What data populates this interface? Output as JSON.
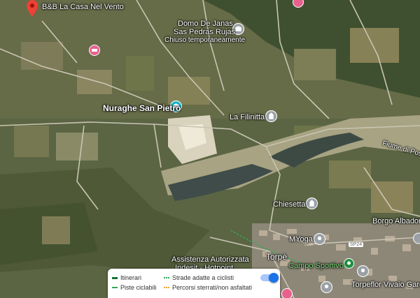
{
  "map": {
    "places": [
      {
        "id": "bb",
        "name": "B&B La Casa Nel Vento"
      },
      {
        "id": "domo",
        "name": "Domo De Janas Sas Pedras Rujas",
        "line1": "Domo De Janas",
        "line2": "Sas Pedras Rujas",
        "status": "Chiuso temporaneamente"
      },
      {
        "id": "nuraghe",
        "name": "Nuraghe San Pietro"
      },
      {
        "id": "filinitta",
        "name": "La Filinitta"
      },
      {
        "id": "fiume",
        "name": "Fiume di Pos"
      },
      {
        "id": "chiesetta",
        "name": "Chiesetta"
      },
      {
        "id": "borgo",
        "name": "Borgo Albador"
      },
      {
        "id": "myoga",
        "name": "MYoga"
      },
      {
        "id": "sp24",
        "name": "SP24"
      },
      {
        "id": "assistenza",
        "line1": "Assistenza Autorizzata",
        "line2": "Indesit - Hotpoint"
      },
      {
        "id": "torpe",
        "name": "Torpè"
      },
      {
        "id": "campo",
        "name": "Campo Sportivo"
      },
      {
        "id": "torpeflor",
        "name": "Torpeflor Vivaio Gard"
      }
    ],
    "colors": {
      "bike_lane": "#137333",
      "bike_friendly": "#34a853",
      "dirt_trail": "#e8a33d",
      "route": "#188038",
      "toggle": "#1a73e8"
    }
  },
  "legend": {
    "itinerari": "Itinerari",
    "piste": "Piste ciclabili",
    "strade": "Strade adatte a ciclisti",
    "percorsi": "Percorsi sterrati/non asfaltati",
    "toggle_on": true
  }
}
